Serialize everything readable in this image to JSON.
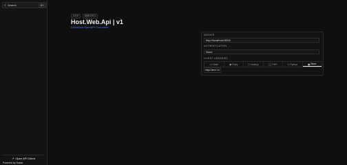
{
  "sidebar": {
    "search": {
      "label": "Search",
      "shortcut": "⌘K"
    },
    "open_api_label": "Open API Client",
    "powered_by": "Powered by Scalar"
  },
  "header": {
    "badges": [
      "1.0.0",
      "OAS 3.0.1"
    ],
    "title": "Host.Web.Api | v1",
    "download_link": "Download OpenAPI Document"
  },
  "panel": {
    "server_label": "SERVER",
    "server_value": "http://localhost:5000",
    "auth_label": "AUTHENTICATION ...",
    "auth_value": "None",
    "client_label": "CLIENT LIBRARIES",
    "tabs": [
      {
        "icon": "shell-icon",
        "label": "Shell"
      },
      {
        "icon": "ruby-icon",
        "label": "Ruby"
      },
      {
        "icon": "nodejs-icon",
        "label": "Node.js"
      },
      {
        "icon": "php-icon",
        "label": "PHP"
      },
      {
        "icon": "python-icon",
        "label": "Python"
      },
      {
        "icon": "more-icon",
        "label": "More"
      }
    ],
    "active_tab": "More",
    "selected_client": "HttpClient  C#"
  }
}
